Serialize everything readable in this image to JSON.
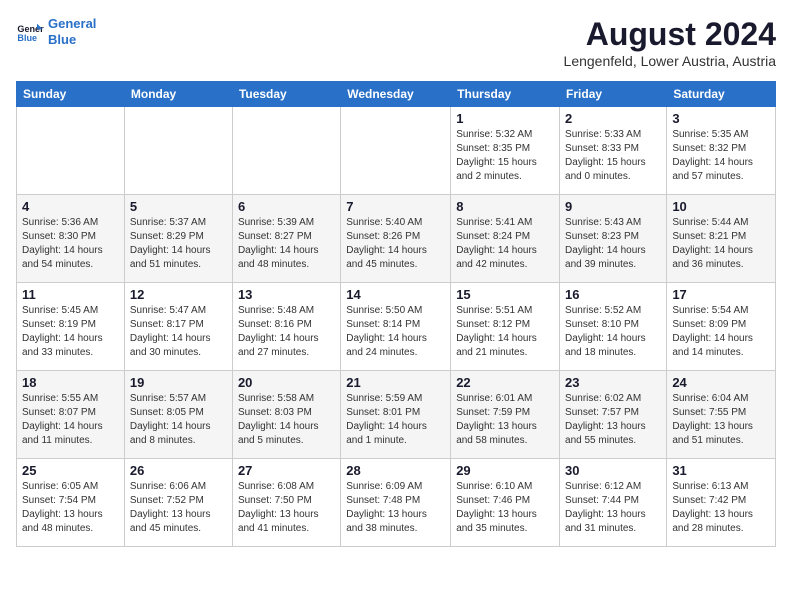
{
  "header": {
    "logo_line1": "General",
    "logo_line2": "Blue",
    "month_year": "August 2024",
    "location": "Lengenfeld, Lower Austria, Austria"
  },
  "weekdays": [
    "Sunday",
    "Monday",
    "Tuesday",
    "Wednesday",
    "Thursday",
    "Friday",
    "Saturday"
  ],
  "weeks": [
    [
      {
        "day": "",
        "info": ""
      },
      {
        "day": "",
        "info": ""
      },
      {
        "day": "",
        "info": ""
      },
      {
        "day": "",
        "info": ""
      },
      {
        "day": "1",
        "info": "Sunrise: 5:32 AM\nSunset: 8:35 PM\nDaylight: 15 hours\nand 2 minutes."
      },
      {
        "day": "2",
        "info": "Sunrise: 5:33 AM\nSunset: 8:33 PM\nDaylight: 15 hours\nand 0 minutes."
      },
      {
        "day": "3",
        "info": "Sunrise: 5:35 AM\nSunset: 8:32 PM\nDaylight: 14 hours\nand 57 minutes."
      }
    ],
    [
      {
        "day": "4",
        "info": "Sunrise: 5:36 AM\nSunset: 8:30 PM\nDaylight: 14 hours\nand 54 minutes."
      },
      {
        "day": "5",
        "info": "Sunrise: 5:37 AM\nSunset: 8:29 PM\nDaylight: 14 hours\nand 51 minutes."
      },
      {
        "day": "6",
        "info": "Sunrise: 5:39 AM\nSunset: 8:27 PM\nDaylight: 14 hours\nand 48 minutes."
      },
      {
        "day": "7",
        "info": "Sunrise: 5:40 AM\nSunset: 8:26 PM\nDaylight: 14 hours\nand 45 minutes."
      },
      {
        "day": "8",
        "info": "Sunrise: 5:41 AM\nSunset: 8:24 PM\nDaylight: 14 hours\nand 42 minutes."
      },
      {
        "day": "9",
        "info": "Sunrise: 5:43 AM\nSunset: 8:23 PM\nDaylight: 14 hours\nand 39 minutes."
      },
      {
        "day": "10",
        "info": "Sunrise: 5:44 AM\nSunset: 8:21 PM\nDaylight: 14 hours\nand 36 minutes."
      }
    ],
    [
      {
        "day": "11",
        "info": "Sunrise: 5:45 AM\nSunset: 8:19 PM\nDaylight: 14 hours\nand 33 minutes."
      },
      {
        "day": "12",
        "info": "Sunrise: 5:47 AM\nSunset: 8:17 PM\nDaylight: 14 hours\nand 30 minutes."
      },
      {
        "day": "13",
        "info": "Sunrise: 5:48 AM\nSunset: 8:16 PM\nDaylight: 14 hours\nand 27 minutes."
      },
      {
        "day": "14",
        "info": "Sunrise: 5:50 AM\nSunset: 8:14 PM\nDaylight: 14 hours\nand 24 minutes."
      },
      {
        "day": "15",
        "info": "Sunrise: 5:51 AM\nSunset: 8:12 PM\nDaylight: 14 hours\nand 21 minutes."
      },
      {
        "day": "16",
        "info": "Sunrise: 5:52 AM\nSunset: 8:10 PM\nDaylight: 14 hours\nand 18 minutes."
      },
      {
        "day": "17",
        "info": "Sunrise: 5:54 AM\nSunset: 8:09 PM\nDaylight: 14 hours\nand 14 minutes."
      }
    ],
    [
      {
        "day": "18",
        "info": "Sunrise: 5:55 AM\nSunset: 8:07 PM\nDaylight: 14 hours\nand 11 minutes."
      },
      {
        "day": "19",
        "info": "Sunrise: 5:57 AM\nSunset: 8:05 PM\nDaylight: 14 hours\nand 8 minutes."
      },
      {
        "day": "20",
        "info": "Sunrise: 5:58 AM\nSunset: 8:03 PM\nDaylight: 14 hours\nand 5 minutes."
      },
      {
        "day": "21",
        "info": "Sunrise: 5:59 AM\nSunset: 8:01 PM\nDaylight: 14 hours\nand 1 minute."
      },
      {
        "day": "22",
        "info": "Sunrise: 6:01 AM\nSunset: 7:59 PM\nDaylight: 13 hours\nand 58 minutes."
      },
      {
        "day": "23",
        "info": "Sunrise: 6:02 AM\nSunset: 7:57 PM\nDaylight: 13 hours\nand 55 minutes."
      },
      {
        "day": "24",
        "info": "Sunrise: 6:04 AM\nSunset: 7:55 PM\nDaylight: 13 hours\nand 51 minutes."
      }
    ],
    [
      {
        "day": "25",
        "info": "Sunrise: 6:05 AM\nSunset: 7:54 PM\nDaylight: 13 hours\nand 48 minutes."
      },
      {
        "day": "26",
        "info": "Sunrise: 6:06 AM\nSunset: 7:52 PM\nDaylight: 13 hours\nand 45 minutes."
      },
      {
        "day": "27",
        "info": "Sunrise: 6:08 AM\nSunset: 7:50 PM\nDaylight: 13 hours\nand 41 minutes."
      },
      {
        "day": "28",
        "info": "Sunrise: 6:09 AM\nSunset: 7:48 PM\nDaylight: 13 hours\nand 38 minutes."
      },
      {
        "day": "29",
        "info": "Sunrise: 6:10 AM\nSunset: 7:46 PM\nDaylight: 13 hours\nand 35 minutes."
      },
      {
        "day": "30",
        "info": "Sunrise: 6:12 AM\nSunset: 7:44 PM\nDaylight: 13 hours\nand 31 minutes."
      },
      {
        "day": "31",
        "info": "Sunrise: 6:13 AM\nSunset: 7:42 PM\nDaylight: 13 hours\nand 28 minutes."
      }
    ]
  ]
}
